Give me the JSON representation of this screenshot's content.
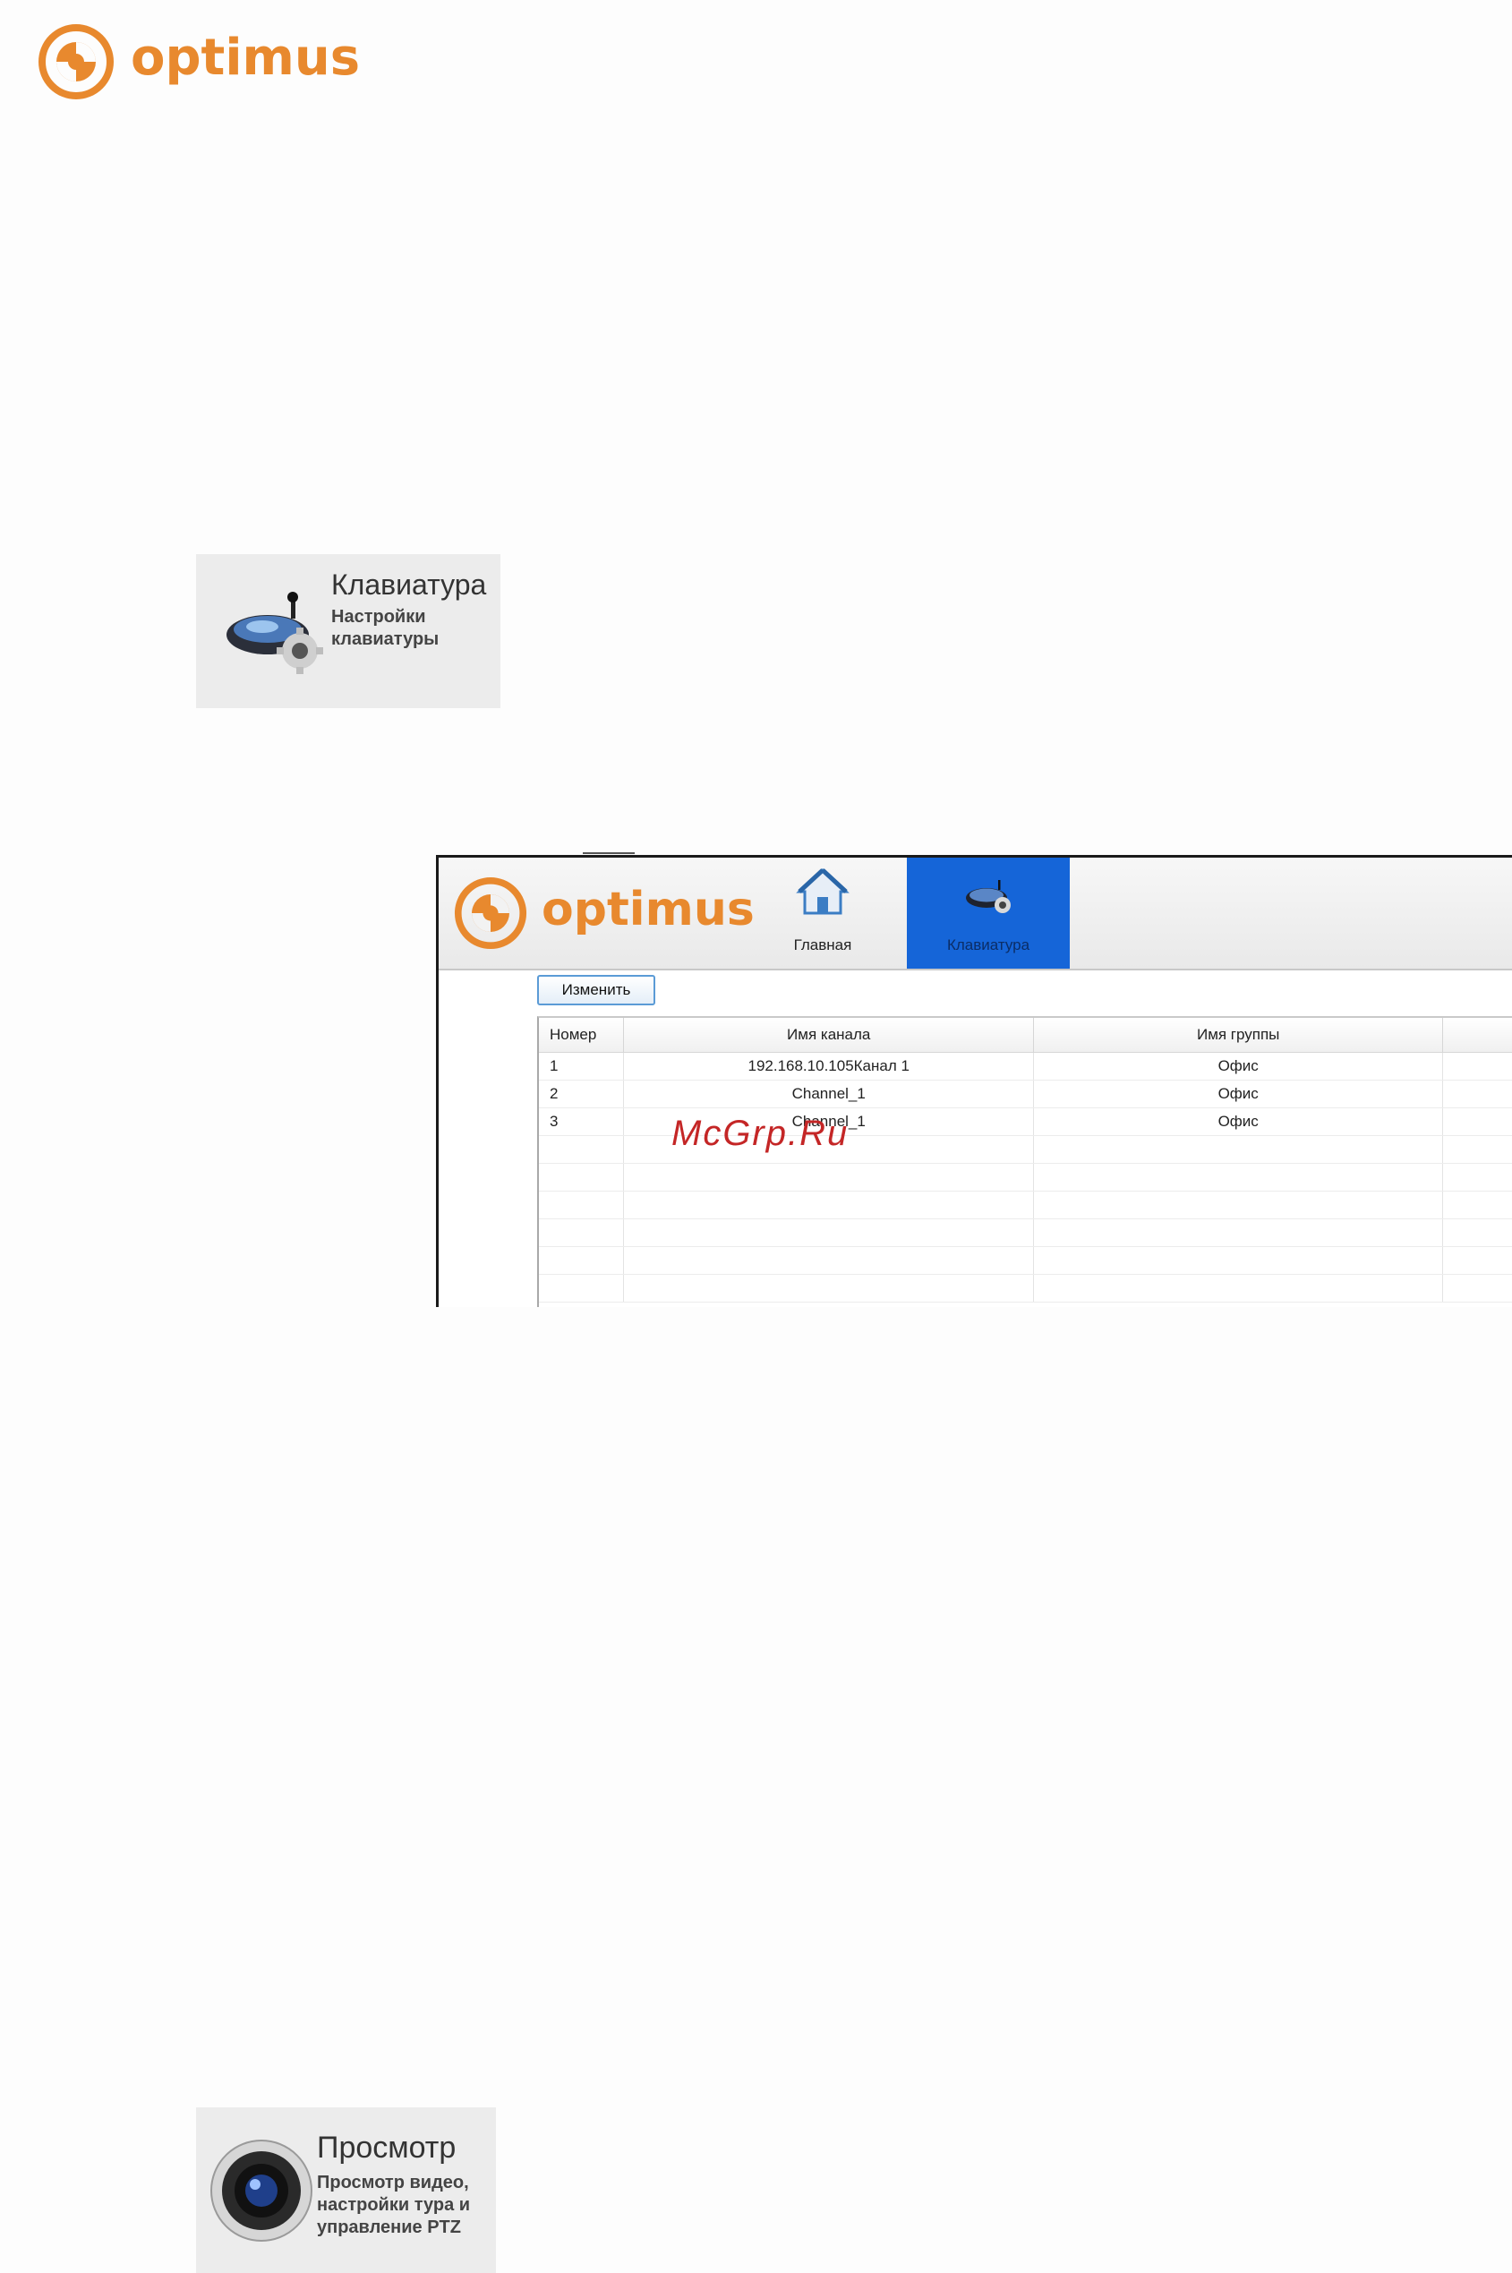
{
  "brand": {
    "name": "optimus",
    "color": "#e8892e"
  },
  "keyboard_tile": {
    "title": "Клавиатура",
    "description_line1": "Настройки",
    "description_line2": "клавиатуры",
    "icon": "keyboard-joystick-icon"
  },
  "app": {
    "logo_text": "optimus",
    "nav": [
      {
        "label": "Главная",
        "icon": "home-icon",
        "active": false
      },
      {
        "label": "Клавиатура",
        "icon": "keyboard-joystick-icon",
        "active": true
      }
    ],
    "accent_color": "#1565d8",
    "edit_button": "Изменить",
    "table": {
      "headers": [
        "Номер",
        "Имя канала",
        "Имя группы",
        ""
      ],
      "rows": [
        [
          "1",
          "192.168.10.105Канал 1",
          "Офис"
        ],
        [
          "2",
          "Channel_1",
          "Офис"
        ],
        [
          "3",
          "Channel_1",
          "Офис"
        ]
      ]
    }
  },
  "watermark": "McGrp.Ru",
  "view_tile": {
    "title": "Просмотр",
    "description_line1": "Просмотр видео,",
    "description_line2": "настройки тура и",
    "description_line3": "управление PTZ",
    "icon": "camera-lens-icon"
  }
}
